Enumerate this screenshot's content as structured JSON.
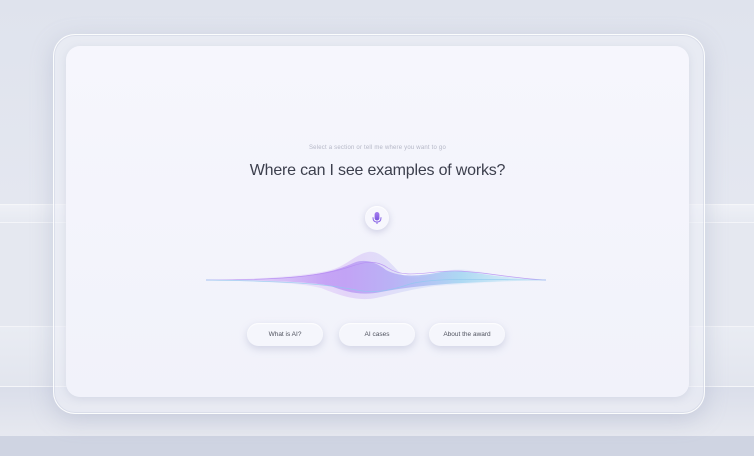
{
  "assistant": {
    "hint": "Select a section or tell me where you want to go",
    "question": "Where can I see examples of works?",
    "mic_icon": "microphone-icon",
    "waveform_colors": [
      "#b98ef5",
      "#8a9bf0",
      "#8fd8ee"
    ]
  },
  "suggestions": [
    {
      "label": "What is AI?"
    },
    {
      "label": "AI cases"
    },
    {
      "label": "About the award"
    }
  ],
  "colors": {
    "accent": "#8e5ce8",
    "screen": "#f4f4fb",
    "text": "#3c3f4d"
  }
}
